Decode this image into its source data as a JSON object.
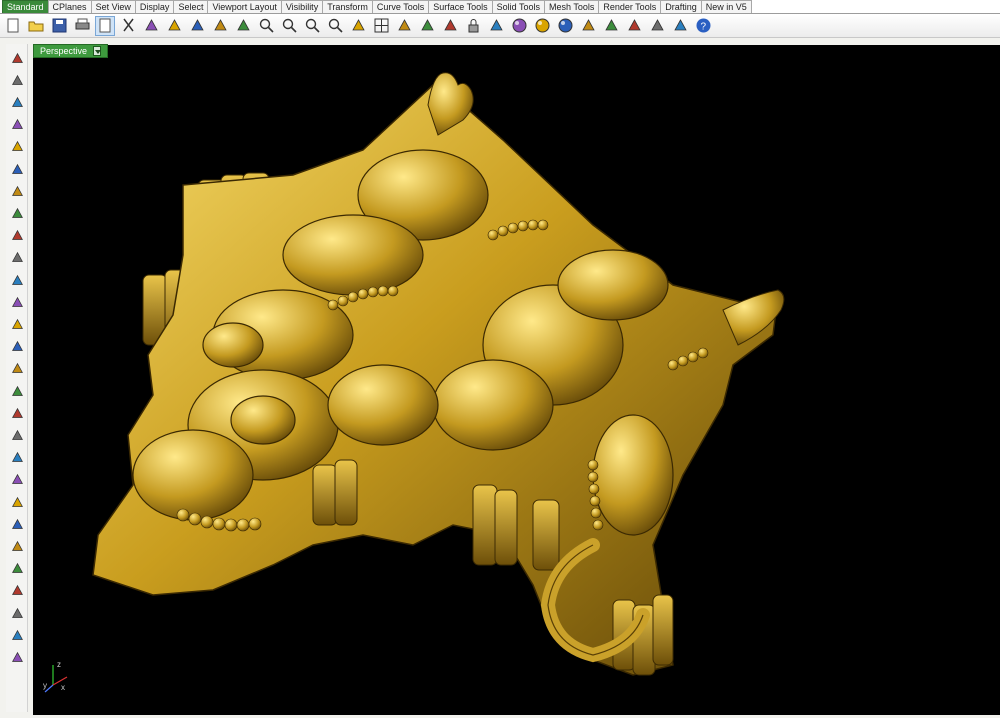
{
  "tabs": [
    "Standard",
    "CPlanes",
    "Set View",
    "Display",
    "Select",
    "Viewport Layout",
    "Visibility",
    "Transform",
    "Curve Tools",
    "Surface Tools",
    "Solid Tools",
    "Mesh Tools",
    "Render Tools",
    "Drafting",
    "New in V5"
  ],
  "active_tab": "Standard",
  "toolbar_icons": [
    "new-icon",
    "open-icon",
    "save-icon",
    "print-icon",
    "blank-icon",
    "cut-icon",
    "copy-icon",
    "paste-icon",
    "undo-icon",
    "pan-icon",
    "move-icon",
    "zoom-icon",
    "zoom-window-icon",
    "zoom-extents-icon",
    "zoom-selected-icon",
    "rotate-view-icon",
    "viewport-grid-icon",
    "layer-icon",
    "show-icon",
    "hide-icon",
    "lock-icon",
    "properties-icon",
    "color-icon",
    "shade-icon",
    "render-sphere-icon",
    "material-icon",
    "light-icon",
    "options-icon",
    "gear-icon",
    "tools-icon",
    "help-icon"
  ],
  "sidebar_icons": [
    "select-icon",
    "point-icon",
    "polyline-icon",
    "curve-icon",
    "circle-icon",
    "arc-icon",
    "polygon-icon",
    "rectangle-icon",
    "ellipse-icon",
    "fillet-icon",
    "surface-icon",
    "extrude-icon",
    "box-icon",
    "boolean-icon",
    "cylinder-icon",
    "mesh-icon",
    "transform-icon",
    "analyze-icon",
    "split-icon",
    "trim-icon",
    "join-icon",
    "explode-icon",
    "group-icon",
    "text-icon",
    "dimension-icon",
    "array-icon",
    "layer-panel-icon",
    "perspective-cube-icon"
  ],
  "sidebar_more": "»",
  "viewport": {
    "label": "Perspective"
  },
  "axis": {
    "z": "z",
    "y": "y",
    "x": "x"
  },
  "colors": {
    "gold": "#c9a227",
    "gold_light": "#f4d66a",
    "gold_dark": "#6a4e08",
    "active_tab": "#3a8a3a",
    "viewport_label": "#3e9a3e"
  }
}
